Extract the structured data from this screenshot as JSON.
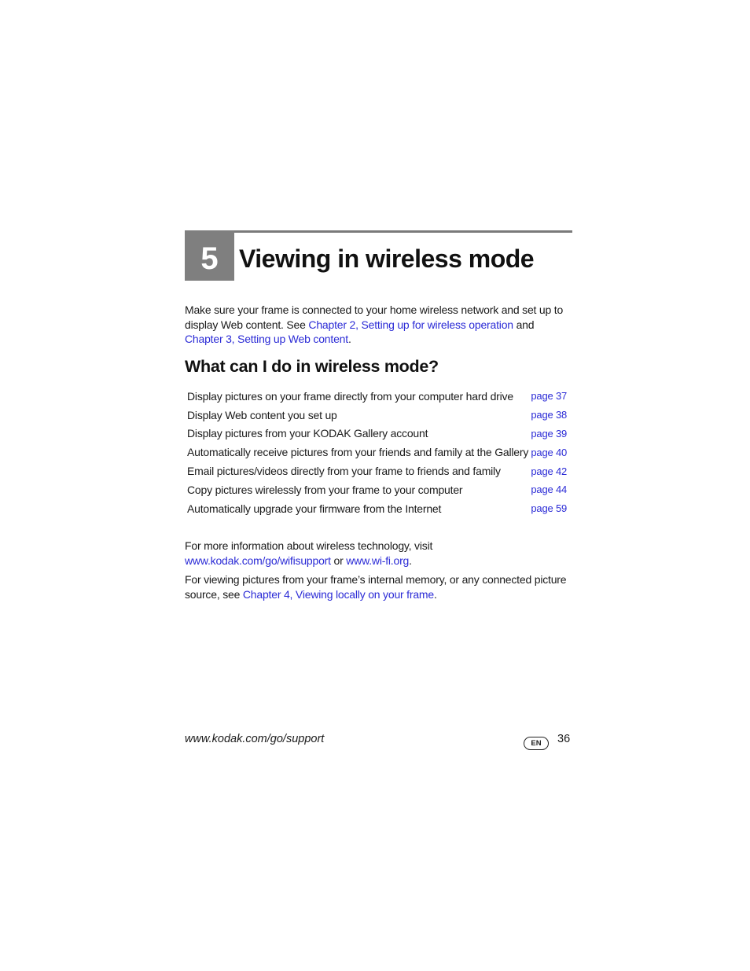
{
  "chapter": {
    "number": "5",
    "title": "Viewing in wireless mode"
  },
  "intro": {
    "text1": "Make sure your frame is connected to your home wireless network and set up to display Web content. See ",
    "link1": "Chapter 2, Setting up for wireless operation",
    "text2": " and ",
    "link2": "Chapter 3, Setting up Web content",
    "text3": "."
  },
  "section": {
    "heading": "What can I do in wireless mode?",
    "rows": [
      {
        "task": "Display pictures on your frame directly from your computer hard drive",
        "page": "page 37"
      },
      {
        "task": "Display Web content you set up",
        "page": "page 38"
      },
      {
        "task": "Display pictures from your KODAK Gallery account",
        "page": "page 39"
      },
      {
        "task": "Automatically receive pictures from your friends and family at the Gallery",
        "page": "page 40"
      },
      {
        "task": "Email pictures/videos directly from your frame to friends and family",
        "page": "page 42"
      },
      {
        "task": "Copy pictures wirelessly from your frame to your computer",
        "page": "page 44"
      },
      {
        "task": "Automatically upgrade your firmware from the Internet",
        "page": "page 59"
      }
    ]
  },
  "more_info": {
    "text1": "For more information about wireless technology, visit ",
    "link1": "www.kodak.com/go/wifisupport",
    "text2": " or ",
    "link2": "www.wi-fi.org",
    "text3": "."
  },
  "local_view": {
    "text1": "For viewing pictures from your frame’s internal memory, or any connected picture source, see ",
    "link1": "Chapter 4, Viewing locally on your frame",
    "text2": "."
  },
  "footer": {
    "url": "www.kodak.com/go/support",
    "language_badge": "EN",
    "page_number": "36"
  }
}
